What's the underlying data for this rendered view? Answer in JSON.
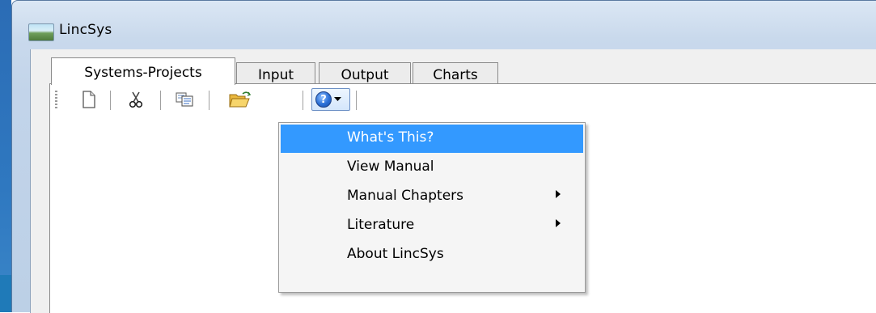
{
  "window": {
    "title": "LincSys"
  },
  "tabs": [
    {
      "label": "Systems-Projects",
      "active": true
    },
    {
      "label": "Input",
      "active": false
    },
    {
      "label": "Output",
      "active": false
    },
    {
      "label": "Charts",
      "active": false
    }
  ],
  "toolbar": {
    "buttons": [
      {
        "name": "new-document",
        "icon": "document-icon"
      },
      {
        "name": "cut",
        "icon": "scissors-icon"
      },
      {
        "name": "copy",
        "icon": "copy-icon"
      },
      {
        "name": "open-folder",
        "icon": "folder-open-icon"
      },
      {
        "name": "help",
        "icon": "help-circle-icon",
        "dropdown": true
      }
    ]
  },
  "menu": {
    "items": [
      {
        "label": "What's This?",
        "highlighted": true,
        "submenu": false
      },
      {
        "label": "View Manual",
        "highlighted": false,
        "submenu": false
      },
      {
        "label": "Manual Chapters",
        "highlighted": false,
        "submenu": true
      },
      {
        "label": "Literature",
        "highlighted": false,
        "submenu": true
      },
      {
        "label": "About LincSys",
        "highlighted": false,
        "submenu": false
      }
    ]
  },
  "colors": {
    "highlight": "#3399ff",
    "frame": "#c2d4ea",
    "desktop": "#2f78c0"
  }
}
